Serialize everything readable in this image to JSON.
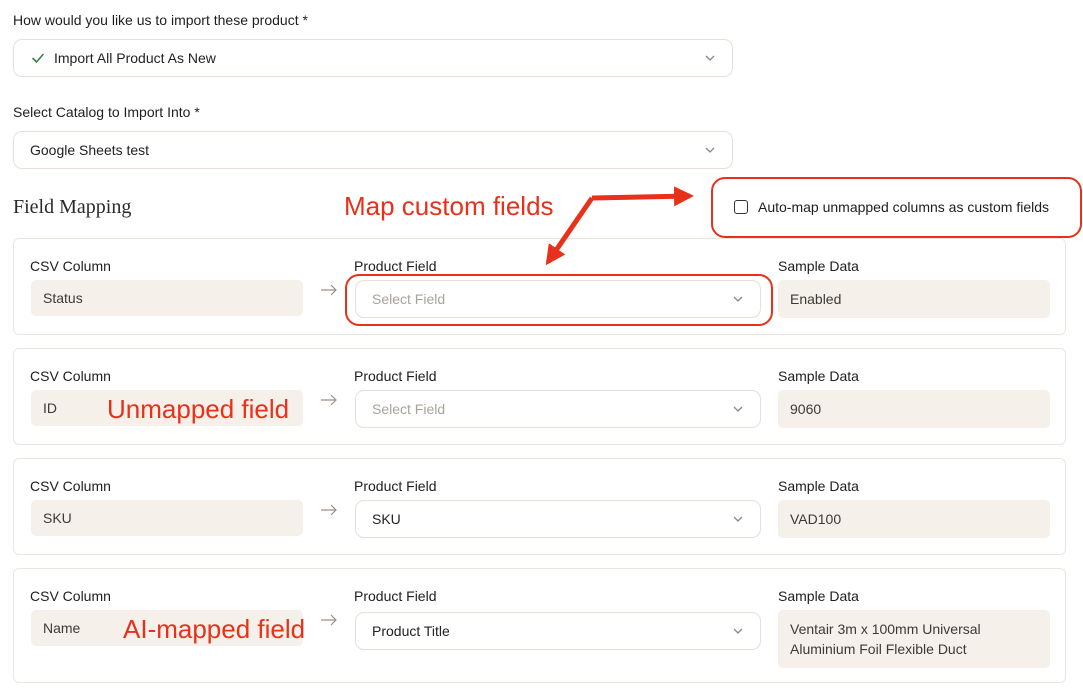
{
  "import_mode": {
    "label": "How would you like us to import these product *",
    "value": "Import All Product As New"
  },
  "catalog": {
    "label": "Select Catalog to Import Into *",
    "value": "Google Sheets test"
  },
  "field_mapping": {
    "title": "Field Mapping",
    "auto_map_label": "Auto-map unmapped columns as custom fields",
    "auto_map_checked": false,
    "col_csv": "CSV Column",
    "col_product": "Product Field",
    "col_sample": "Sample Data",
    "rows": [
      {
        "csv": "Status",
        "field": "",
        "placeholder": "Select Field",
        "sample": "Enabled"
      },
      {
        "csv": "ID",
        "field": "",
        "placeholder": "Select Field",
        "sample": "9060"
      },
      {
        "csv": "SKU",
        "field": "SKU",
        "placeholder": "Select Field",
        "sample": "VAD100"
      },
      {
        "csv": "Name",
        "field": "Product Title",
        "placeholder": "Select Field",
        "sample": "Ventair 3m x 100mm Universal Aluminium Foil Flexible Duct"
      }
    ]
  },
  "annotations": {
    "map_custom": "Map custom fields",
    "unmapped": "Unmapped field",
    "ai_mapped": "AI-mapped field",
    "color": "#e8311a"
  }
}
